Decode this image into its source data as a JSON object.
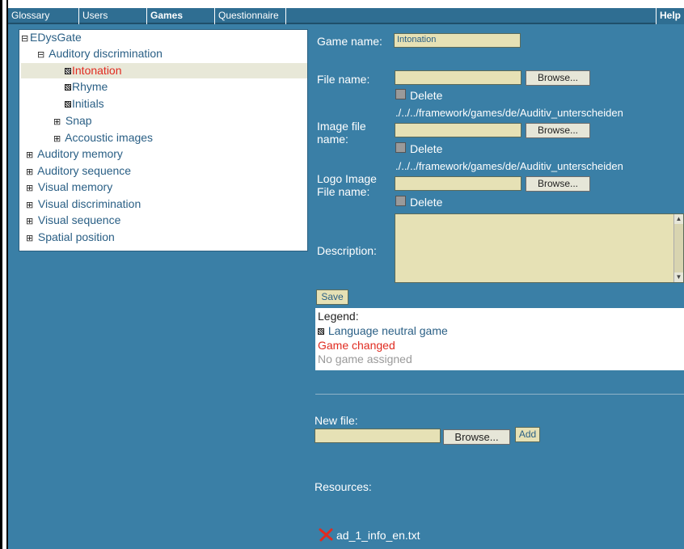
{
  "tabs": [
    {
      "label": "Glossary",
      "active": false
    },
    {
      "label": "Users",
      "active": false
    },
    {
      "label": "Games",
      "active": true
    },
    {
      "label": "Questionnaire",
      "active": false
    }
  ],
  "help_label": "Help",
  "tree": {
    "root": "EDysGate",
    "items": [
      {
        "label": "Auditory discrimination",
        "toggle": "⊟"
      },
      {
        "label": "Intonation",
        "icon": "language-neutral-icon",
        "selected": true,
        "changed": true
      },
      {
        "label": "Rhyme",
        "icon": "language-neutral-icon"
      },
      {
        "label": "Initials",
        "icon": "language-neutral-icon"
      },
      {
        "label": "Snap",
        "toggle": "⊞"
      },
      {
        "label": "Accoustic images",
        "toggle": "⊞"
      },
      {
        "label": "Auditory memory",
        "toggle": "⊞"
      },
      {
        "label": "Auditory sequence",
        "toggle": "⊞"
      },
      {
        "label": "Visual memory",
        "toggle": "⊞"
      },
      {
        "label": "Visual discrimination",
        "toggle": "⊞"
      },
      {
        "label": "Visual sequence",
        "toggle": "⊞"
      },
      {
        "label": "Spatial position",
        "toggle": "⊞"
      }
    ]
  },
  "form": {
    "game_name_label": "Game name:",
    "game_name_value": "Intonation",
    "file_name_label": "File name:",
    "image_file_label": "Image file name:",
    "image_path": "./../../framework/games/de/Auditiv_unterscheiden",
    "logo_file_label": "Logo Image File name:",
    "logo_path": "./../../framework/games/de/Auditiv_unterscheiden",
    "browse_label": "Browse...",
    "delete_label": "Delete",
    "description_label": "Description:",
    "save_label": "Save"
  },
  "legend": {
    "title": "Legend:",
    "neutral": "Language neutral game",
    "changed": "Game changed",
    "unassigned": "No game assigned"
  },
  "newfile": {
    "label": "New file:",
    "browse_label": "Browse...",
    "add_label": "Add"
  },
  "resources": {
    "label": "Resources:",
    "files": [
      "ad_1_info_en.txt"
    ]
  },
  "colors": {
    "background": "#3a7fa6",
    "input": "#e6e1b5",
    "changed": "#e02b20",
    "unassigned": "#9a9a9a"
  }
}
